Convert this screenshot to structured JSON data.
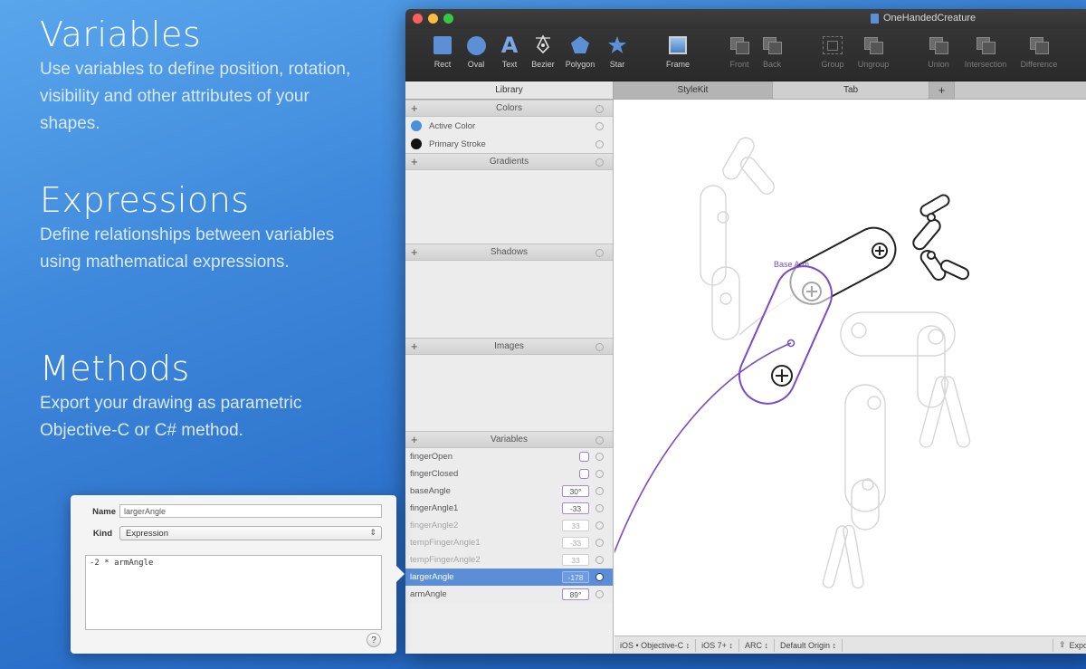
{
  "promo": {
    "variables": {
      "title": "Variables",
      "text": "Use variables to define position, rotation, visibility and other attributes of your shapes."
    },
    "expressions": {
      "title": "Expressions",
      "text": "Define relationships between variables using mathematical expressions."
    },
    "methods": {
      "title": "Methods",
      "text": "Export your drawing as parametric Objective-C or C# method."
    }
  },
  "window": {
    "title": "OneHandedCreature"
  },
  "toolbar": {
    "rect": "Rect",
    "oval": "Oval",
    "text": "Text",
    "text_glyph": "A",
    "bezier": "Bezier",
    "polygon": "Polygon",
    "star": "Star",
    "frame": "Frame",
    "front": "Front",
    "back": "Back",
    "group": "Group",
    "ungroup": "Ungroup",
    "union": "Union",
    "intersection": "Intersection",
    "difference": "Difference"
  },
  "tabs": {
    "library": "Library",
    "stylekit": "StyleKit",
    "tab": "Tab",
    "add": "+"
  },
  "sections": {
    "plus": "+",
    "colors": "Colors",
    "gradients": "Gradients",
    "shadows": "Shadows",
    "images": "Images",
    "variables": "Variables"
  },
  "colors": [
    {
      "name": "Active Color",
      "hex": "#4a90d9"
    },
    {
      "name": "Primary Stroke",
      "hex": "#111111"
    }
  ],
  "variables": [
    {
      "name": "fingerOpen",
      "value": ""
    },
    {
      "name": "fingerClosed",
      "value": ""
    },
    {
      "name": "baseAngle",
      "value": "30°"
    },
    {
      "name": "fingerAngle1",
      "value": "-33"
    },
    {
      "name": "fingerAngle2",
      "value": "33"
    },
    {
      "name": "tempFingerAngle1",
      "value": "-33"
    },
    {
      "name": "tempFingerAngle2",
      "value": "33"
    },
    {
      "name": "largerAngle",
      "value": "-178"
    },
    {
      "name": "armAngle",
      "value": "89°"
    }
  ],
  "canvas": {
    "label": "Base Arm"
  },
  "statusbar": {
    "language": "iOS • Objective-C ↕",
    "target": "iOS 7+ ↕",
    "memory": "ARC ↕",
    "origin": "Default Origin ↕",
    "export": "Expo"
  },
  "popover": {
    "name_label": "Name",
    "name_value": "largerAngle",
    "kind_label": "Kind",
    "kind_value": "Expression",
    "expression": "-2 * armAngle",
    "help": "?"
  },
  "accent": {
    "purple": "#7a4bc2",
    "selection": "#5b8ed7"
  }
}
